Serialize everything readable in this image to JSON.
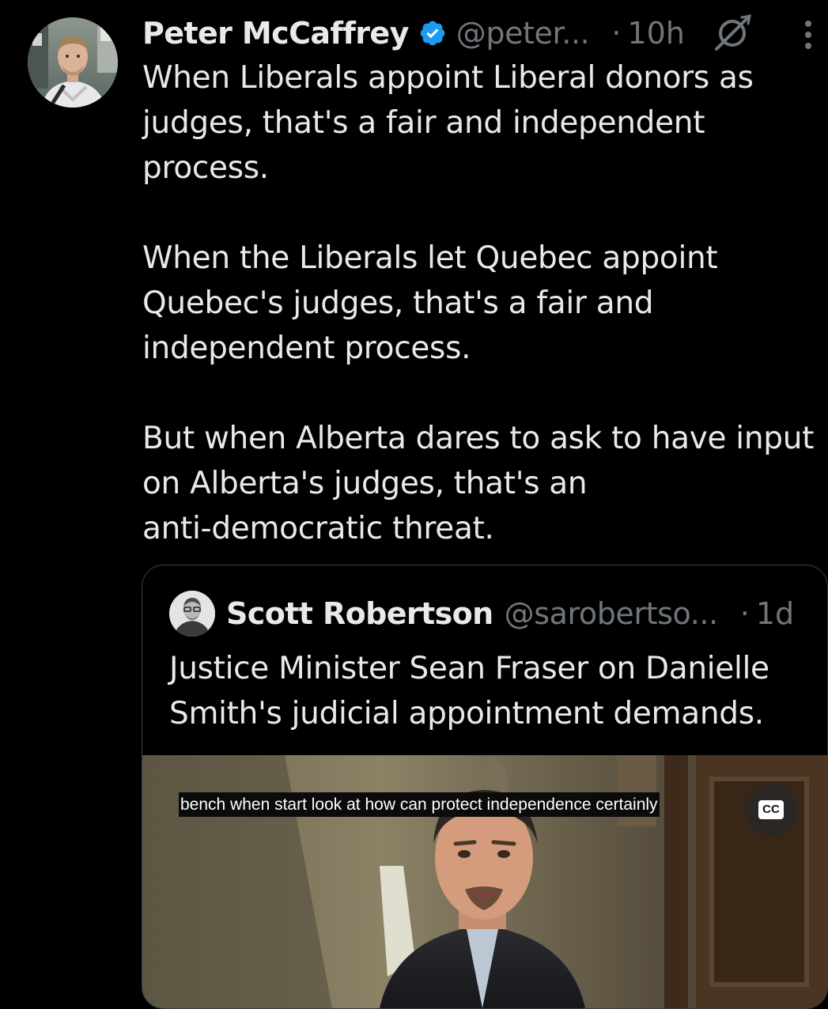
{
  "tweet": {
    "author_name": "Peter McCaffrey",
    "handle": "@peter...",
    "separator": "·",
    "time": "10h",
    "paragraphs": [
      "When Liberals appoint Liberal donors as\njudges, that's a fair and independent\nprocess.",
      "When the Liberals let Quebec appoint\nQuebec's judges, that's a fair and\nindependent process.",
      "But when Alberta dares to ask to have input\non Alberta's judges, that's an\nanti-democratic threat."
    ]
  },
  "quote": {
    "author_name": "Scott Robertson",
    "handle": "@sarobertso...",
    "separator": "·",
    "time": "1d",
    "text": "Justice Minister Sean Fraser on Danielle\nSmith's judicial appointment demands.",
    "video": {
      "caption": "bench when start look at how can protect independence certainly",
      "cc_label": "CC"
    }
  },
  "colors": {
    "background": "#000000",
    "text": "#e7e9ea",
    "secondary": "#71767b",
    "verified": "#1d9bf0",
    "border": "#3a3f44"
  },
  "icons": {
    "verified": "verified-badge-icon",
    "grok": "grok-icon",
    "more": "more-vertical-icon",
    "cc": "closed-captions-icon"
  }
}
